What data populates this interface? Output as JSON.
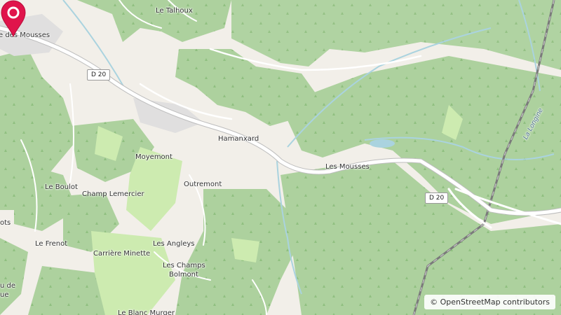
{
  "map": {
    "places": [
      {
        "id": "le-talhoux",
        "name": "Le Talhoux"
      },
      {
        "id": "rue-des-mousses",
        "name": "e des Mousses"
      },
      {
        "id": "hamanxard",
        "name": "Hamanxard"
      },
      {
        "id": "moyemont",
        "name": "Moyemont"
      },
      {
        "id": "les-mousses",
        "name": "Les Mousses"
      },
      {
        "id": "le-boulot",
        "name": "Le Boulot"
      },
      {
        "id": "champ-lemercier",
        "name": "Champ Lemercier"
      },
      {
        "id": "outremont",
        "name": "Outremont"
      },
      {
        "id": "ots",
        "name": "ots"
      },
      {
        "id": "le-frenot",
        "name": "Le Frenot"
      },
      {
        "id": "carriere-minette",
        "name": "Carrière Minette"
      },
      {
        "id": "les-angleys",
        "name": "Les Angleys"
      },
      {
        "id": "les-champs-bolmont-1",
        "name": "Les Champs"
      },
      {
        "id": "les-champs-bolmont-2",
        "name": "Bolmont"
      },
      {
        "id": "u-de",
        "name": "u de"
      },
      {
        "id": "ue",
        "name": "ue"
      },
      {
        "id": "le-blanc-murger",
        "name": "Le Blanc Murger"
      }
    ],
    "river_label": "La Longine",
    "roads": [
      {
        "id": "d20-west",
        "ref": "D 20"
      },
      {
        "id": "d20-east",
        "ref": "D 20"
      }
    ],
    "marker_label": "Selected location",
    "attribution": "© OpenStreetMap contributors",
    "colors": {
      "land": "#f2efe9",
      "forest": "#add19e",
      "meadow": "#cdebb0",
      "water": "#aad3df",
      "road": "#ffffff",
      "railway": "#7a7a7a",
      "marker": "#e0144b"
    }
  }
}
